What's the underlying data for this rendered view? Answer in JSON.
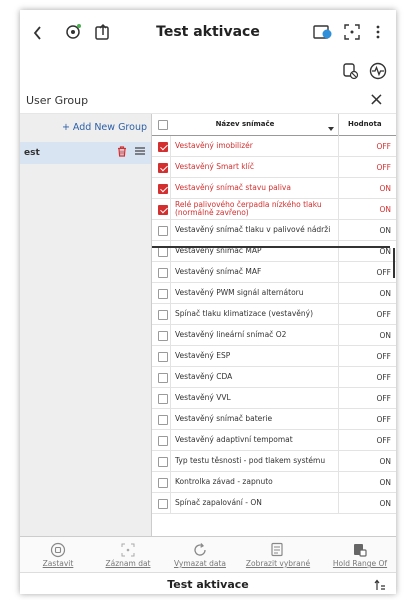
{
  "header": {
    "title": "Test aktivace",
    "back_icon": "chevron-left-icon",
    "car_icon": "car-settings-icon",
    "export_icon": "export-icon",
    "record_icon": "record-icon",
    "fullscreen_icon": "focus-icon",
    "more_icon": "more-vertical-icon"
  },
  "subbar": {
    "icons": [
      "car-off-icon",
      "waveform-icon"
    ]
  },
  "user_group": {
    "label": "User Group",
    "close": "×",
    "add_label": "+ Add New Group",
    "groups": [
      {
        "name": "est"
      }
    ]
  },
  "table": {
    "col_name": "Název snímače",
    "col_value": "Hodnota",
    "rows": [
      {
        "name": "Vestavěný imobilizér",
        "value": "OFF",
        "checked": true
      },
      {
        "name": "Vestavěný Smart klíč",
        "value": "OFF",
        "checked": true
      },
      {
        "name": "Vestavěný snímač stavu paliva",
        "value": "ON",
        "checked": true
      },
      {
        "name": "Relé palivového čerpadla nízkého tlaku (normálně zavřeno)",
        "value": "ON",
        "checked": true
      },
      {
        "name": "Vestavěný snímač tlaku v palivové nádrži",
        "value": "ON",
        "checked": false
      },
      {
        "name": "Vestavěný snímač MAP",
        "value": "ON",
        "checked": false
      },
      {
        "name": "Vestavěný snímač MAF",
        "value": "OFF",
        "checked": false
      },
      {
        "name": "Vestavěný PWM signál alternátoru",
        "value": "ON",
        "checked": false
      },
      {
        "name": "Spínač tlaku klimatizace (vestavěný)",
        "value": "OFF",
        "checked": false
      },
      {
        "name": "Vestavěný lineární snímač O2",
        "value": "ON",
        "checked": false
      },
      {
        "name": "Vestavěný ESP",
        "value": "OFF",
        "checked": false
      },
      {
        "name": "Vestavěný CDA",
        "value": "OFF",
        "checked": false
      },
      {
        "name": "Vestavěný VVL",
        "value": "OFF",
        "checked": false
      },
      {
        "name": "Vestavěný snímač baterie",
        "value": "OFF",
        "checked": false
      },
      {
        "name": "Vestavěný adaptivní tempomat",
        "value": "OFF",
        "checked": false
      },
      {
        "name": "Typ testu těsnosti - pod tlakem systému",
        "value": "ON",
        "checked": false
      },
      {
        "name": "Kontrolka závad - zapnuto",
        "value": "ON",
        "checked": false
      },
      {
        "name": "Spínač zapalování - ON",
        "value": "ON",
        "checked": false
      }
    ]
  },
  "toolbar": {
    "items": [
      {
        "label": "Zastavit",
        "icon": "stop-icon"
      },
      {
        "label": "Záznam dat",
        "icon": "record-data-icon"
      },
      {
        "label": "Vymazat data",
        "icon": "refresh-icon"
      },
      {
        "label": "Zobrazit vybrané",
        "icon": "show-selected-icon"
      },
      {
        "label": "Hold Range Of",
        "icon": "hold-range-icon"
      }
    ]
  },
  "footer": {
    "title": "Test aktivace",
    "icon": "expand-icon"
  },
  "colors": {
    "accent": "#d32f2f",
    "link": "#2c5fa8",
    "group_highlight": "#d9e4f3"
  }
}
